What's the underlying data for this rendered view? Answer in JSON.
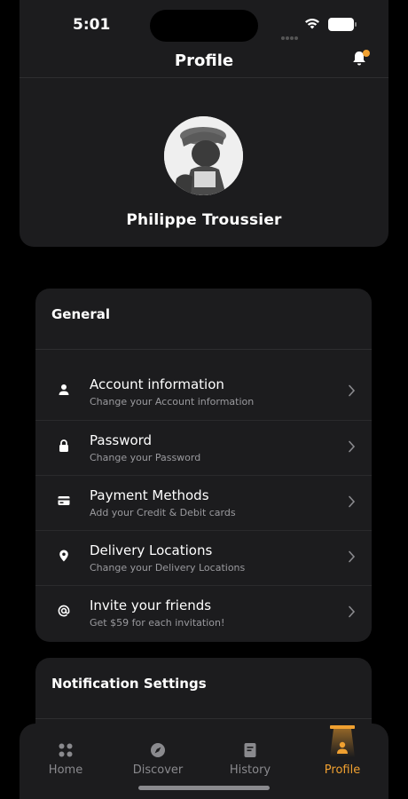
{
  "status_bar": {
    "time": "5:01"
  },
  "header": {
    "title": "Profile"
  },
  "profile": {
    "name": "Philippe Troussier"
  },
  "general": {
    "title": "General",
    "items": [
      {
        "icon": "person-icon",
        "label": "Account information",
        "subtitle": "Change your Account information"
      },
      {
        "icon": "lock-icon",
        "label": "Password",
        "subtitle": "Change your Password"
      },
      {
        "icon": "credit-card-icon",
        "label": "Payment Methods",
        "subtitle": "Add your Credit & Debit cards"
      },
      {
        "icon": "location-pin-icon",
        "label": "Delivery Locations",
        "subtitle": "Change your Delivery Locations"
      },
      {
        "icon": "at-sign-icon",
        "label": "Invite your friends",
        "subtitle": "Get $59 for each invitation!"
      }
    ]
  },
  "notification_settings": {
    "title": "Notification Settings"
  },
  "tabs": [
    {
      "icon": "home-grid-icon",
      "label": "Home",
      "active": false
    },
    {
      "icon": "compass-icon",
      "label": "Discover",
      "active": false
    },
    {
      "icon": "history-icon",
      "label": "History",
      "active": false
    },
    {
      "icon": "profile-icon",
      "label": "Profile",
      "active": true
    }
  ],
  "colors": {
    "accent": "#f0a030",
    "background": "#000000",
    "card": "#1c1c1e",
    "subtext": "#9a9a9e"
  }
}
